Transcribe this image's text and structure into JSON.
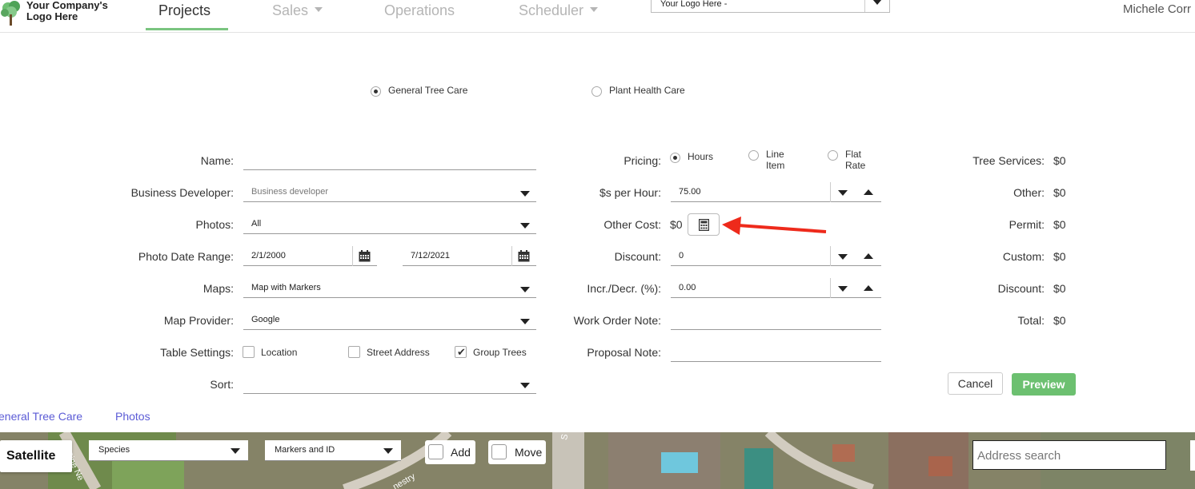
{
  "nav": {
    "logo_line1": "Your Company's",
    "logo_line2": "Logo Here",
    "tabs": [
      {
        "label": "Projects",
        "active": true
      },
      {
        "label": "Sales",
        "dropdown": true
      },
      {
        "label": "Operations"
      },
      {
        "label": "Scheduler",
        "dropdown": true
      }
    ],
    "company_select": "Your Logo Here -",
    "user": "Michele Corr"
  },
  "type_options": [
    {
      "label": "General Tree Care",
      "selected": true
    },
    {
      "label": "Plant Health Care",
      "selected": false
    }
  ],
  "left_form": {
    "name_label": "Name:",
    "name_value": "",
    "bd_label": "Business Developer:",
    "bd_placeholder": "Business developer",
    "photos_label": "Photos:",
    "photos_value": "All",
    "date_label": "Photo Date Range:",
    "date_from": "2/1/2000",
    "date_to": "7/12/2021",
    "maps_label": "Maps:",
    "maps_value": "Map with Markers",
    "provider_label": "Map Provider:",
    "provider_value": "Google",
    "table_label": "Table Settings:",
    "table_options": [
      {
        "label": "Location",
        "checked": false
      },
      {
        "label": "Street Address",
        "checked": false
      },
      {
        "label": "Group Trees",
        "checked": true
      }
    ],
    "sort_label": "Sort:",
    "sort_value": ""
  },
  "mid_form": {
    "pricing_label": "Pricing:",
    "pricing_options": [
      {
        "label": "Hours",
        "selected": true
      },
      {
        "label1": "Line",
        "label2": "Item",
        "selected": false
      },
      {
        "label1": "Flat",
        "label2": "Rate",
        "selected": false
      }
    ],
    "per_hour_label": "$s per Hour:",
    "per_hour_value": "75.00",
    "other_cost_label": "Other Cost:",
    "other_cost_value": "$0",
    "discount_label": "Discount:",
    "discount_value": "0",
    "incr_label": "Incr./Decr. (%):",
    "incr_value": "0.00",
    "wo_note_label": "Work Order Note:",
    "wo_note_value": "",
    "proposal_label": "Proposal Note:",
    "proposal_value": ""
  },
  "totals": [
    {
      "label": "Tree Services:",
      "value": "$0"
    },
    {
      "label": "Other:",
      "value": "$0"
    },
    {
      "label": "Permit:",
      "value": "$0"
    },
    {
      "label": "Custom:",
      "value": "$0"
    },
    {
      "label": "Discount:",
      "value": "$0"
    },
    {
      "label": "Total:",
      "value": "$0"
    }
  ],
  "buttons": {
    "cancel": "Cancel",
    "preview": "Preview"
  },
  "bottom_tabs": [
    "eneral Tree Care",
    "Photos"
  ],
  "map": {
    "type_button": "Satellite",
    "species_select": "Species",
    "markers_select": "Markers and ID",
    "add_label": "Add",
    "move_label": "Move",
    "address_placeholder": "Address search",
    "street_labels": [
      "Pine Ne",
      "nestry",
      "S"
    ]
  },
  "colors": {
    "accent_green": "#6cc070",
    "link": "#5b5bd6",
    "arrow": "#ee2a1b"
  }
}
